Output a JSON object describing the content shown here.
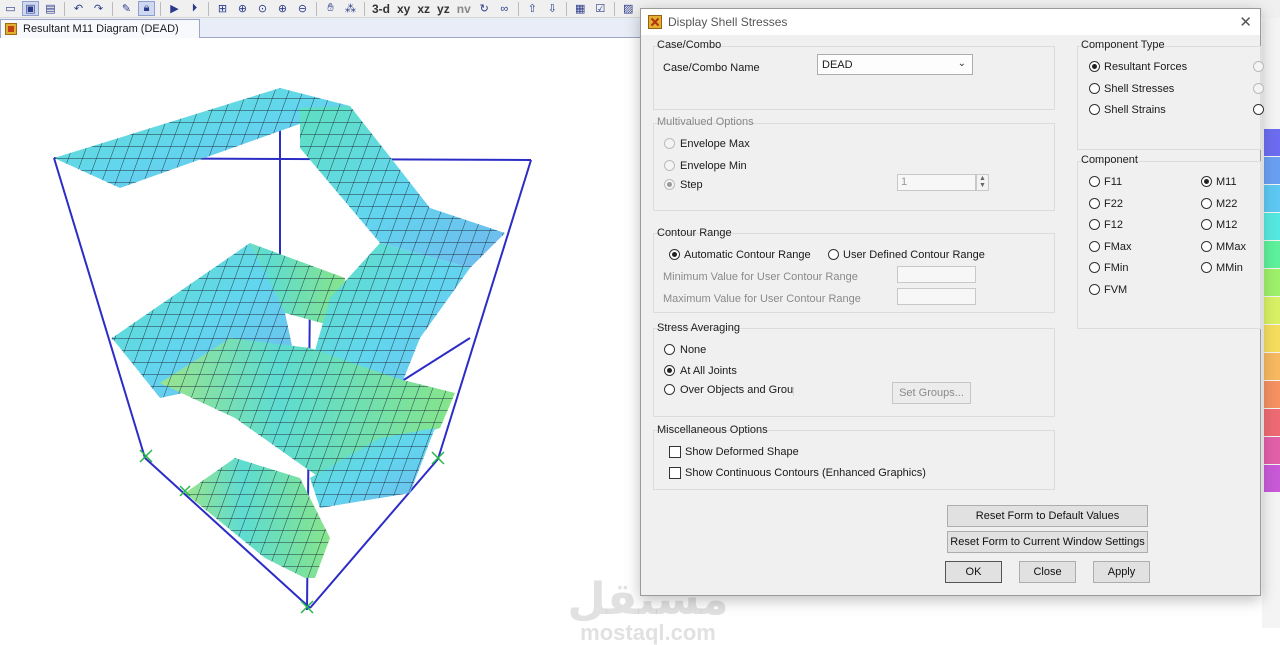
{
  "toolbar": {
    "view_buttons": [
      "3-d",
      "xy",
      "xz",
      "yz",
      "nv"
    ]
  },
  "viewport": {
    "tab_label": "Resultant M11 Diagram   (DEAD)"
  },
  "watermark": {
    "arabic": "مستقل",
    "latin": "mostaql.com"
  },
  "legend_colors": [
    "#6c6cf0",
    "#6a9ff2",
    "#5ec8f2",
    "#55e8e0",
    "#5ef09a",
    "#9ef06a",
    "#d8f064",
    "#f4dc5e",
    "#f6b860",
    "#f49062",
    "#ee6a72",
    "#e260a8",
    "#c85ad8"
  ],
  "dialog": {
    "title": "Display Shell Stresses",
    "case_combo": {
      "group_title": "Case/Combo",
      "name_label": "Case/Combo Name",
      "selected": "DEAD"
    },
    "multivalued": {
      "group_title": "Multivalued Options",
      "envelope_max": "Envelope Max",
      "envelope_min": "Envelope Min",
      "step": "Step",
      "step_value": "1"
    },
    "contour_range": {
      "group_title": "Contour Range",
      "automatic": "Automatic Contour Range",
      "user_defined": "User Defined Contour Range",
      "min_label": "Minimum Value for User Contour Range",
      "max_label": "Maximum Value for User Contour Range"
    },
    "stress_averaging": {
      "group_title": "Stress Averaging",
      "none": "None",
      "all_joints": "At All Joints",
      "objects_groups": "Over Objects and Groups",
      "set_groups": "Set Groups..."
    },
    "misc": {
      "group_title": "Miscellaneous Options",
      "deformed": "Show Deformed Shape",
      "continuous": "Show Continuous Contours (Enhanced Graphics)"
    },
    "component_type": {
      "group_title": "Component Type",
      "resultant_forces": "Resultant Forces",
      "shell_stresses": "Shell Stresses",
      "shell_strains": "Shell Strains"
    },
    "component": {
      "group_title": "Component",
      "left": [
        "F11",
        "F22",
        "F12",
        "FMax",
        "FMin",
        "FVM"
      ],
      "right": [
        "M11",
        "M22",
        "M12",
        "MMax",
        "MMin"
      ],
      "selected": "M11"
    },
    "buttons": {
      "reset_default": "Reset Form to Default Values",
      "reset_window": "Reset Form to Current Window Settings",
      "ok": "OK",
      "close": "Close",
      "apply": "Apply"
    }
  }
}
